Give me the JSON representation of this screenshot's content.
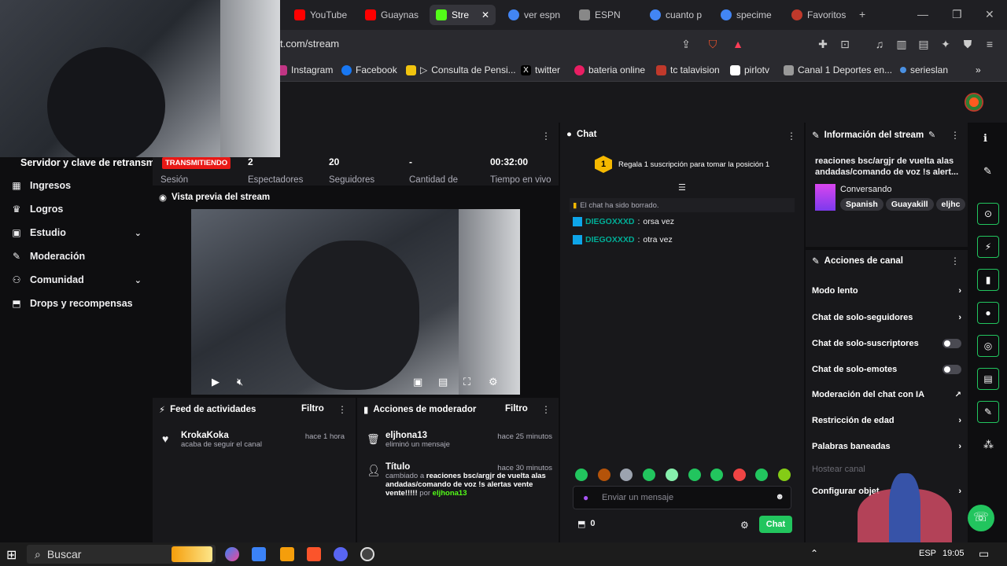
{
  "browser": {
    "tabs": [
      {
        "label": "YouTube",
        "color": "#ff0000"
      },
      {
        "label": "Guaynas",
        "color": "#ff0000"
      },
      {
        "label": "Stre",
        "color": "#53fc18",
        "active": true
      },
      {
        "label": "ver espn",
        "color": "#4285f4"
      },
      {
        "label": "ESPN",
        "color": "#888888"
      },
      {
        "label": "cuanto p",
        "color": "#4285f4"
      },
      {
        "label": "specime",
        "color": "#4285f4"
      },
      {
        "label": "Favoritos",
        "color": "#c0392b"
      }
    ],
    "url": "t.com/stream",
    "bookmarks": [
      {
        "label": "Instagram",
        "color": "#c13584"
      },
      {
        "label": "Facebook",
        "color": "#1877f2"
      },
      {
        "label": "Consulta de Pensi...",
        "color": "#f1c40f"
      },
      {
        "label": "twitter",
        "color": "#000000"
      },
      {
        "label": "bateria online",
        "color": "#e91e63"
      },
      {
        "label": "tc talavision",
        "color": "#c0392b"
      },
      {
        "label": "pirlotv",
        "color": "#ffffff"
      },
      {
        "label": "Canal 1 Deportes en...",
        "color": "#999999"
      },
      {
        "label": "serieslan",
        "color": "#4a90e2"
      }
    ]
  },
  "sidebar": {
    "title": "Servidor y clave de retransm",
    "items": [
      {
        "label": "Ingresos",
        "icon": "wallet-icon",
        "glyph": "▦"
      },
      {
        "label": "Logros",
        "icon": "trophy-icon",
        "glyph": "♛"
      },
      {
        "label": "Estudio",
        "icon": "studio-icon",
        "glyph": "▣",
        "chevron": "⌄"
      },
      {
        "label": "Moderación",
        "icon": "wrench-icon",
        "glyph": "✎"
      },
      {
        "label": "Comunidad",
        "icon": "people-icon",
        "glyph": "⚇",
        "chevron": "⌄"
      },
      {
        "label": "Drops y recompensas",
        "icon": "gift-icon",
        "glyph": "⬒"
      }
    ]
  },
  "stats": {
    "live_badge": "TRANSMITIENDO",
    "items": [
      {
        "value": "2",
        "label": "Espectadores"
      },
      {
        "value": "20",
        "label": "Seguidores"
      },
      {
        "value": "-",
        "label": "Cantidad de"
      },
      {
        "value": "00:32:00",
        "label": "Tiempo en vivo"
      }
    ],
    "left_label": "Sesión"
  },
  "preview": {
    "title": "Vista previa del stream"
  },
  "feed": {
    "title": "Feed de actividades",
    "filter": "Filtro",
    "events": [
      {
        "name": "KrokaKoka",
        "sub": "acaba de seguir el canal",
        "time": "hace 1 hora"
      }
    ]
  },
  "modactions": {
    "title": "Acciones de moderador",
    "filter": "Filtro",
    "events": [
      {
        "name": "eljhona13",
        "sub": "eliminó un mensaje",
        "time": "hace 25 minutos"
      },
      {
        "name": "Título",
        "sub_prefix": "cambiado a ",
        "sub_bold": "reaciones bsc/argjr de vuelta alas andadas/comando de voz !s alertas vente vente!!!!!",
        "sub_by": " por ",
        "sub_user": "eljhona13",
        "time": "hace 30 minutos"
      }
    ]
  },
  "chat": {
    "title": "Chat",
    "gift_rank": "1",
    "gift_text": "Regala 1 suscripción para tomar la posición 1",
    "cleared": "El chat ha sido borrado.",
    "messages": [
      {
        "user": "DIEGOXXXD",
        "text": "orsa vez"
      },
      {
        "user": "DIEGOXXXD",
        "text": "otra vez"
      }
    ],
    "placeholder": "Enviar un mensaje",
    "points": "0",
    "send_label": "Chat"
  },
  "info": {
    "title": "Información del stream",
    "stream_title": "reaciones bsc/argjr de vuelta alas andadas/comando de voz !s alert...",
    "category": "Conversando",
    "tags": [
      "Spanish",
      "Guayakill",
      "eljhc"
    ]
  },
  "actions": {
    "title": "Acciones de canal",
    "rows": [
      {
        "label": "Modo lento",
        "type": "chevron"
      },
      {
        "label": "Chat de solo-seguidores",
        "type": "chevron"
      },
      {
        "label": "Chat de solo-suscriptores",
        "type": "toggle"
      },
      {
        "label": "Chat de solo-emotes",
        "type": "toggle"
      },
      {
        "label": "Moderación del chat con IA",
        "type": "external"
      },
      {
        "label": "Restricción de edad",
        "type": "chevron"
      },
      {
        "label": "Palabras baneadas",
        "type": "chevron"
      },
      {
        "label": "Hostear canal",
        "type": "disabled"
      },
      {
        "label": "Configurar objet",
        "type": "chevron"
      }
    ]
  },
  "taskbar": {
    "search": "Buscar",
    "time": "19:05",
    "lang": "ESP"
  }
}
